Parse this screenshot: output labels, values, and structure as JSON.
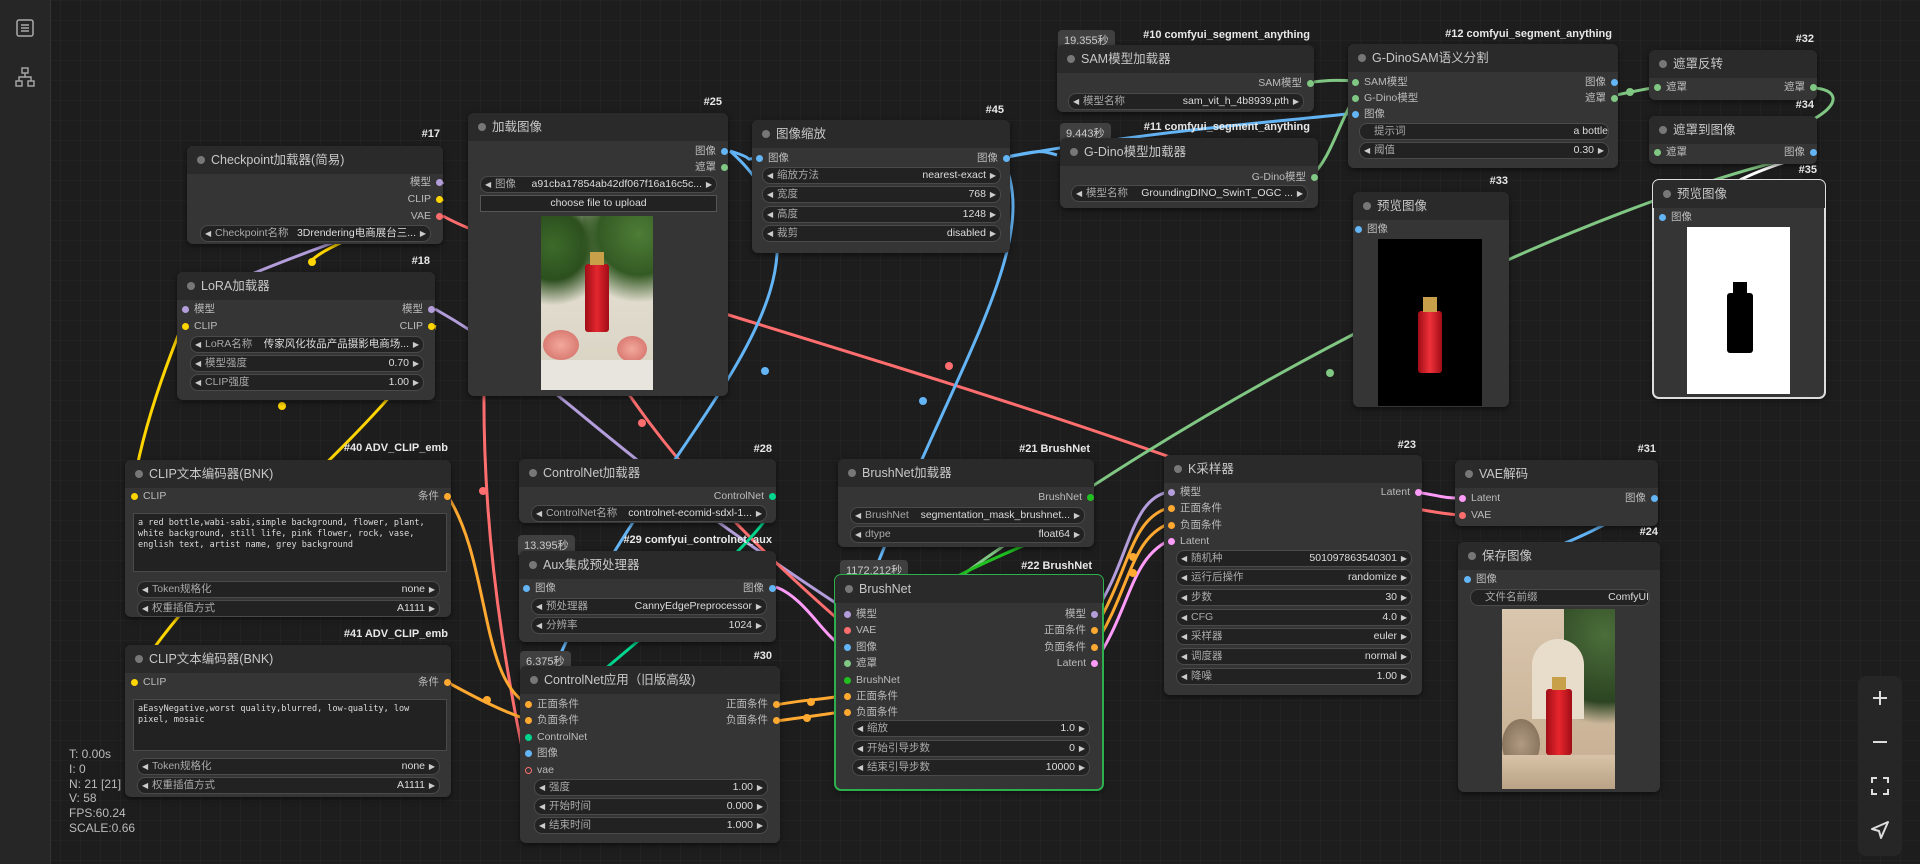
{
  "stats": {
    "t": "T: 0.00s",
    "i": "I: 0",
    "n": "N: 21 [21]",
    "v": "V: 58",
    "fps": "FPS:60.24",
    "scale": "SCALE:0.66"
  },
  "nodes": {
    "ckpt": {
      "badge": "#17",
      "title": "Checkpoint加载器(简易)",
      "out": [
        "模型",
        "CLIP",
        "VAE"
      ],
      "w_label": "Checkpoint名称",
      "w_value": "3Drendering电商展台三..."
    },
    "lora": {
      "badge": "#18",
      "title": "LoRA加载器",
      "in": [
        "模型",
        "CLIP"
      ],
      "out": [
        "模型",
        "CLIP"
      ],
      "w": [
        [
          "LoRA名称",
          "传家风化妆品产品摄影电商场..."
        ],
        [
          "模型强度",
          "0.70"
        ],
        [
          "CLIP强度",
          "1.00"
        ]
      ]
    },
    "load": {
      "badge": "#25",
      "title": "加载图像",
      "out": [
        "图像",
        "遮罩"
      ],
      "w_label": "图像",
      "w_value": "a91cba17854ab42df067f16a16c5c...",
      "upload": "choose file to upload"
    },
    "scale": {
      "badge": "#45",
      "title": "图像缩放",
      "in": [
        "图像"
      ],
      "out": [
        "图像"
      ],
      "w": [
        [
          "缩放方法",
          "nearest-exact"
        ],
        [
          "宽度",
          "768"
        ],
        [
          "高度",
          "1248"
        ],
        [
          "裁剪",
          "disabled"
        ]
      ]
    },
    "sam": {
      "time": "19.355秒",
      "badge": "#10 comfyui_segment_anything",
      "title": "SAM模型加载器",
      "out": [
        "SAM模型"
      ],
      "w_label": "模型名称",
      "w_value": "sam_vit_h_4b8939.pth"
    },
    "gdino": {
      "time": "9.443秒",
      "badge": "#11 comfyui_segment_anything",
      "title": "G-Dino模型加载器",
      "out": [
        "G-Dino模型"
      ],
      "w_label": "模型名称",
      "w_value": "GroundingDINO_SwinT_OGC ..."
    },
    "gdsam": {
      "badge": "#12 comfyui_segment_anything",
      "title": "G-DinoSAM语义分割",
      "in": [
        "SAM模型",
        "G-Dino模型",
        "图像"
      ],
      "out": [
        "图像",
        "遮罩"
      ],
      "w": [
        [
          "提示词",
          "a bottle"
        ],
        [
          "阈值",
          "0.30"
        ]
      ]
    },
    "inv": {
      "badge": "#32",
      "title": "遮罩反转",
      "in": [
        "遮罩"
      ],
      "out": [
        "遮罩"
      ]
    },
    "m2i": {
      "badge": "#34",
      "title": "遮罩到图像",
      "in": [
        "遮罩"
      ],
      "out": [
        "图像"
      ]
    },
    "prev33": {
      "badge": "#33",
      "title": "预览图像",
      "in": [
        "图像"
      ]
    },
    "prev35": {
      "badge": "#35",
      "title": "预览图像",
      "in": [
        "图像"
      ]
    },
    "clip40": {
      "badge": "#40 ADV_CLIP_emb",
      "title": "CLIP文本编码器(BNK)",
      "in": [
        "CLIP"
      ],
      "out": [
        "条件"
      ],
      "text": "a red bottle,wabi-sabi,simple background, flower, plant, white background, still life, pink flower, rock, vase, english text, artist name, grey background",
      "w": [
        [
          "Token规格化",
          "none"
        ],
        [
          "权重插值方式",
          "A1111"
        ]
      ]
    },
    "clip41": {
      "badge": "#41 ADV_CLIP_emb",
      "title": "CLIP文本编码器(BNK)",
      "in": [
        "CLIP"
      ],
      "out": [
        "条件"
      ],
      "text": "aEasyNegative,worst quality,blurred, low-quality, low pixel, mosaic",
      "w": [
        [
          "Token规格化",
          "none"
        ],
        [
          "权重插值方式",
          "A1111"
        ]
      ]
    },
    "cnload": {
      "badge": "#28",
      "title": "ControlNet加载器",
      "out": [
        "ControlNet"
      ],
      "w_label": "ControlNet名称",
      "w_value": "controlnet-ecomid-sdxl-1..."
    },
    "aux": {
      "time": "13.395秒",
      "badge": "#29 comfyui_controlnet_aux",
      "title": "Aux集成预处理器",
      "in": [
        "图像"
      ],
      "out": [
        "图像"
      ],
      "w": [
        [
          "预处理器",
          "CannyEdgePreprocessor"
        ],
        [
          "分辨率",
          "1024"
        ]
      ]
    },
    "cnapply": {
      "time": "6.375秒",
      "badge": "#30",
      "title": "ControlNet应用（旧版高级)",
      "in": [
        "正面条件",
        "负面条件",
        "ControlNet",
        "图像",
        "vae"
      ],
      "out": [
        "正面条件",
        "负面条件"
      ],
      "w": [
        [
          "强度",
          "1.00"
        ],
        [
          "开始时间",
          "0.000"
        ],
        [
          "结束时间",
          "1.000"
        ]
      ]
    },
    "bnload": {
      "badge": "#21 BrushNet",
      "title": "BrushNet加载器",
      "out": [
        "BrushNet"
      ],
      "w": [
        [
          "BrushNet",
          "segmentation_mask_brushnet..."
        ],
        [
          "dtype",
          "float64"
        ]
      ]
    },
    "brushnet": {
      "time": "1172.212秒",
      "badge": "#22 BrushNet",
      "title": "BrushNet",
      "in": [
        "模型",
        "VAE",
        "图像",
        "遮罩",
        "BrushNet",
        "正面条件",
        "负面条件"
      ],
      "out": [
        "模型",
        "正面条件",
        "负面条件",
        "Latent"
      ],
      "w": [
        [
          "缩放",
          "1.0"
        ],
        [
          "开始引导步数",
          "0"
        ],
        [
          "结束引导步数",
          "10000"
        ]
      ]
    },
    "ksampler": {
      "badge": "#23",
      "title": "K采样器",
      "in": [
        "模型",
        "正面条件",
        "负面条件",
        "Latent"
      ],
      "out": [
        "Latent"
      ],
      "w": [
        [
          "随机种",
          "501097863540301"
        ],
        [
          "运行后操作",
          "randomize"
        ],
        [
          "步数",
          "30"
        ],
        [
          "CFG",
          "4.0"
        ],
        [
          "采样器",
          "euler"
        ],
        [
          "调度器",
          "normal"
        ],
        [
          "降噪",
          "1.00"
        ]
      ]
    },
    "vaedec": {
      "badge": "#31",
      "title": "VAE解码",
      "in": [
        "Latent",
        "VAE"
      ],
      "out": [
        "图像"
      ]
    },
    "save": {
      "badge": "#24",
      "title": "保存图像",
      "in": [
        "图像"
      ],
      "w_label": "文件名前缀",
      "w_value": "ComfyUI"
    }
  },
  "colors": {
    "model": "#b39ddb",
    "clip": "#ffd500",
    "vae": "#ff6e6e",
    "image": "#64b5f6",
    "mask": "#81c784",
    "cond": "#ffa931",
    "latent": "#ff9cf9",
    "controlnet": "#00d78d",
    "brushnet": "#20c020",
    "sam": "#81c784"
  }
}
